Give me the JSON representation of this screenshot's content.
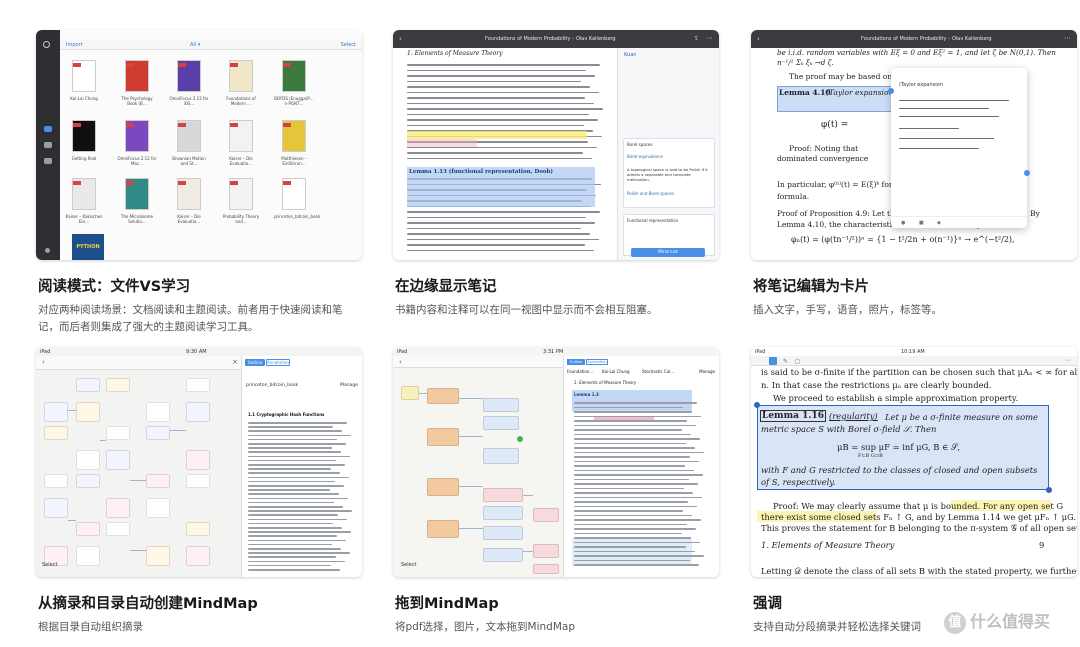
{
  "cards": [
    {
      "title": "阅读模式：文件VS学习",
      "desc": "对应两种阅读场景：文档阅读和主题阅读。前者用于快速阅读和笔记，而后者则集成了强大的主题阅读学习工具。"
    },
    {
      "title": "在边缘显示笔记",
      "desc": "书籍内容和注释可以在同一视图中显示而不会相互阻塞。"
    },
    {
      "title": "将笔记编辑为卡片",
      "desc": "插入文字，手写，语音，照片，标签等。"
    },
    {
      "title": "从摘录和目录自动创建MindMap",
      "desc": "根据目录自动组织摘录"
    },
    {
      "title": "拖到MindMap",
      "desc": "将pdf选择，图片，文本拖到MindMap"
    },
    {
      "title": "强调",
      "desc": "支持自动分段摘录并轻松选择关键词"
    }
  ],
  "shot1": {
    "import_label": "Import",
    "sort_label": "All ▾",
    "select_label": "Select",
    "books": [
      "Kai-Lai Chung",
      "The Psychology Book (Big Ideas…Explained)",
      "OmniFocus 2.12 for iOS User…Omni Group",
      "Foundations of Modern Pr…Kallenberg",
      "BOYDS (Enugga)P…n-PGNTEE)",
      "Getting Real",
      "OmniFocus 2.12 for Mac User…mni Group",
      "Brownian Motion and Stochastic Calculus",
      "Kaiser – Die Evaluation…rossmann",
      "Matthiesen – Einführung…",
      "Kaiser – Kakisches Einfried…t_vorrossman",
      "The Microbiome Solution",
      "Kaiser – Die Evaluatio…rossmann",
      "Probability Theory and Examples (4th Edition)",
      "princeton_bitcoin_book"
    ],
    "python_cover": "PYTHON"
  },
  "shot2": {
    "title": "Foundations of Modern Probability – Olav Kallenberg",
    "heading": "1. Elements of Measure Theory",
    "lemma": "Lemma 1.13 (functional representation, Doob)",
    "side_header": "Kuan",
    "notes": [
      "Borel spaces",
      "Borel-equivalence",
      "A topological space is said to be Polish if it admits a separable and complete metrization.",
      "Polish and Borel spaces",
      "Functional representation"
    ],
    "button": "Mind List"
  },
  "shot3": {
    "title": "Foundations of Modern Probability – Olav Kallenberg",
    "popup_title": "(Taylor expansion",
    "lemma": "Lemma 4.10",
    "lemma_rest": "(Taylor expansion)",
    "text1": "be i.i.d. random variables with Eξ = 0 and Eξ² = 1, and let ζ be N(0,1). Then n⁻¹/² Σₖ ξₖ →d ζ.",
    "text2": "The proof may be based on a",
    "text3": "Proof: Noting that",
    "text4": "dominated convergence",
    "text5": "In particular, φ⁽ⁿ⁾(t) = E(ξ)ᵏ for",
    "text6": "formula.",
    "text7": "Proof of Proposition 4.9: Let the ξₖ have characteristic function φ. By Lemma 4.10, the characteristic function of n⁻¹/²Sₙ equals",
    "formula": "φₙ(t) = (φ(tn⁻¹/²))ⁿ = {1 − t²/2n + o(n⁻¹)}ⁿ → e^(−t²/2),"
  },
  "shot4": {
    "time": "9:30 AM",
    "tab_a": "Outline",
    "tab_b": "Annotation",
    "book": "princeton_bitcoin_book",
    "manage": "Manage",
    "section": "1.1 Cryptographic Hash Functions",
    "select": "Select"
  },
  "shot5": {
    "time": "3:31 PM",
    "tab_a": "Outline",
    "tab_b": "Annotation",
    "col_a": "Foundation…",
    "col_b": "Kai-Lai Chung",
    "col_c": "Stochastic Cal…",
    "manage": "Manage",
    "section": "1. Elements of Measure Theory",
    "lemma": "Lemma 1.3",
    "select": "Select"
  },
  "shot6": {
    "time": "10:19 AM",
    "line1": "is said to be σ-finite if the partition can be chosen such that μAₙ < ∞ for all",
    "line2": "n. In that case the restrictions μₙ are clearly bounded.",
    "line3": "We proceed to establish a simple approximation property.",
    "lemma": "Lemma",
    "lemma_num": "1.16",
    "lemma_name": "(regularity)",
    "lemma_text": "Let μ be a σ-finite measure on some metric space S with Borel σ-field 𝒮. Then",
    "formula": "μB = sup μF = inf μG,   B ∈ 𝒮,",
    "formula_sub": "F⊂B         G⊃B",
    "lemma_text2": "with F and G restricted to the classes of closed and open subsets of S, respectively.",
    "proof1": "Proof: We may clearly assume that μ is bounded. For any open set G",
    "proof2": "there exist some closed sets Fₙ ↑ G, and by Lemma 1.14 we get μFₙ ↑ μG.",
    "proof3": "This proves the statement for B belonging to the π-system 𝒢 of all open sets.",
    "footer": "1. Elements of Measure Theory",
    "page": "9",
    "last": "Letting 𝒟 denote the class of all sets B with the stated property, we further"
  },
  "watermark": "值 什么值得买"
}
